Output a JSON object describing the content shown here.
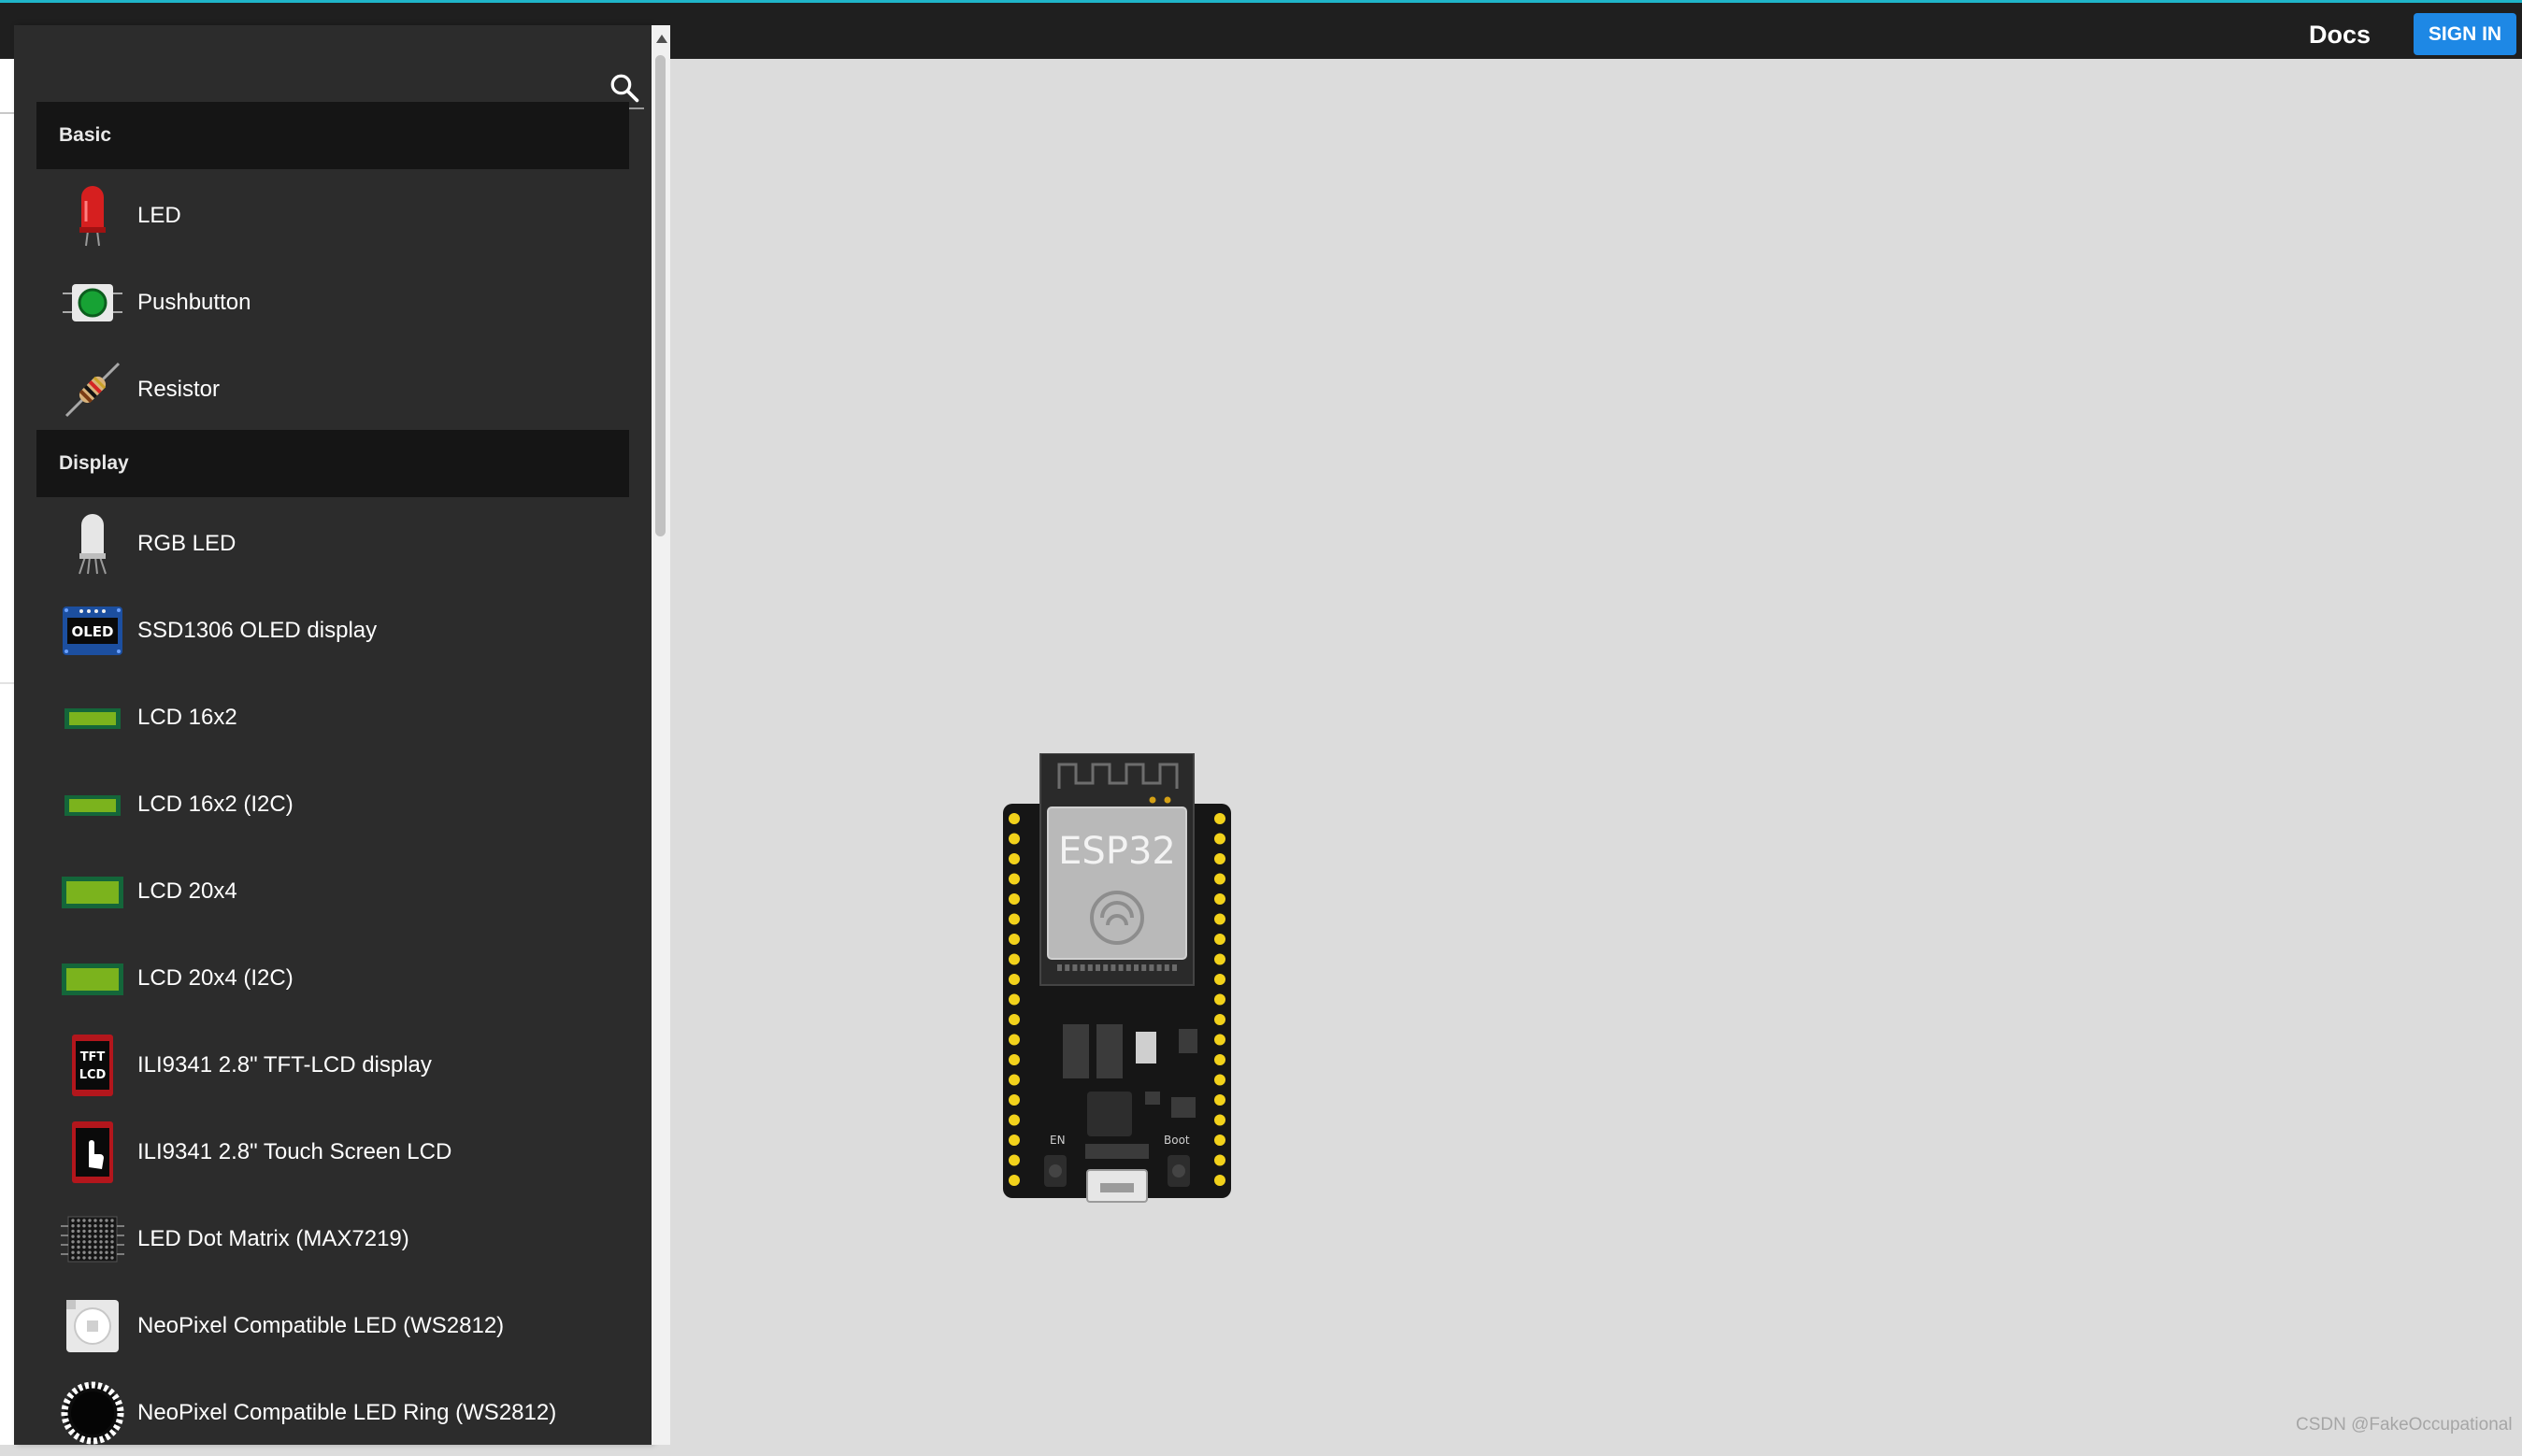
{
  "topbar": {
    "docs_label": "Docs",
    "signin_label": "SIGN IN"
  },
  "search": {
    "value": "",
    "placeholder": ""
  },
  "categories": [
    {
      "title": "Basic",
      "items": [
        {
          "label": "LED",
          "icon": "led-icon"
        },
        {
          "label": "Pushbutton",
          "icon": "pushbutton-icon"
        },
        {
          "label": "Resistor",
          "icon": "resistor-icon"
        }
      ]
    },
    {
      "title": "Display",
      "items": [
        {
          "label": "RGB LED",
          "icon": "rgb-led-icon"
        },
        {
          "label": "SSD1306 OLED display",
          "icon": "oled-icon",
          "icon_text": "OLED"
        },
        {
          "label": "LCD 16x2",
          "icon": "lcd-icon"
        },
        {
          "label": "LCD 16x2 (I2C)",
          "icon": "lcd-icon"
        },
        {
          "label": "LCD 20x4",
          "icon": "lcd-icon"
        },
        {
          "label": "LCD 20x4 (I2C)",
          "icon": "lcd-icon"
        },
        {
          "label": "ILI9341 2.8\" TFT-LCD display",
          "icon": "tft-lcd-icon",
          "icon_text": [
            "TFT",
            "LCD"
          ]
        },
        {
          "label": "ILI9341 2.8\" Touch Screen LCD",
          "icon": "touch-screen-icon"
        },
        {
          "label": "LED Dot Matrix (MAX7219)",
          "icon": "dot-matrix-icon"
        },
        {
          "label": "NeoPixel Compatible LED (WS2812)",
          "icon": "neopixel-icon"
        },
        {
          "label": "NeoPixel Compatible LED Ring (WS2812)",
          "icon": "neopixel-ring-icon"
        }
      ]
    }
  ],
  "canvas": {
    "board": {
      "label": "ESP32",
      "button_left": "EN",
      "button_right": "Boot",
      "icon": "esp32-board-icon"
    }
  },
  "watermark": "CSDN @FakeOccupational",
  "colors": {
    "accent": "#1e88e5",
    "topbar": "#1f1f1f",
    "panel": "#2c2c2c",
    "category": "#151515",
    "canvas": "#dcdcdc",
    "top_line": "#1fb5c9"
  }
}
